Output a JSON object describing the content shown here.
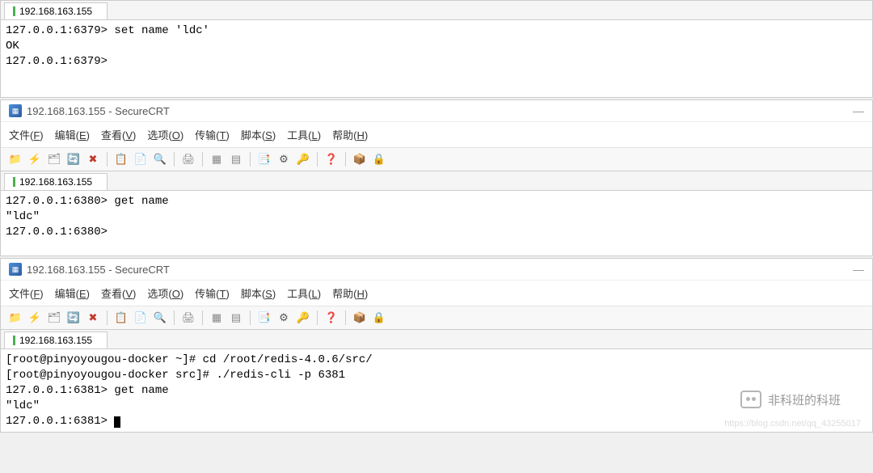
{
  "windows": [
    {
      "tab": "192.168.163.155",
      "terminal": "127.0.0.1:6379> set name 'ldc'\nOK\n127.0.0.1:6379>"
    },
    {
      "title": "192.168.163.155 - SecureCRT",
      "menu": {
        "file": "文件(F)",
        "edit": "编辑(E)",
        "view": "查看(V)",
        "options": "选项(O)",
        "transfer": "传输(T)",
        "script": "脚本(S)",
        "tools": "工具(L)",
        "help": "帮助(H)"
      },
      "tab": "192.168.163.155",
      "terminal": "127.0.0.1:6380> get name\n\"ldc\"\n127.0.0.1:6380>"
    },
    {
      "title": "192.168.163.155 - SecureCRT",
      "menu": {
        "file": "文件(F)",
        "edit": "编辑(E)",
        "view": "查看(V)",
        "options": "选项(O)",
        "transfer": "传输(T)",
        "script": "脚本(S)",
        "tools": "工具(L)",
        "help": "帮助(H)"
      },
      "tab": "192.168.163.155",
      "terminal": "[root@pinyoyougou-docker ~]# cd /root/redis-4.0.6/src/\n[root@pinyoyougou-docker src]# ./redis-cli -p 6381\n127.0.0.1:6381> get name\n\"ldc\"\n127.0.0.1:6381> "
    }
  ],
  "watermark_text": "非科班的科班",
  "url_hint": "https://blog.csdn.net/qq_43255017"
}
